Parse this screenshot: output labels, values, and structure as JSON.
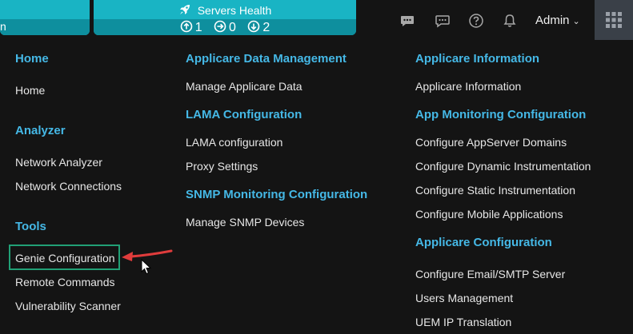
{
  "topbar": {
    "left_tile_fragment": "n",
    "servers_health": {
      "title": "Servers Health",
      "up_count": "1",
      "neutral_count": "0",
      "down_count": "2"
    },
    "icons": [
      "chat-bubble-icon",
      "comments-icon",
      "help-icon",
      "bell-icon"
    ],
    "user_label": "Admin",
    "apps_icon": "grid-icon"
  },
  "menu": {
    "col1": {
      "home_heading": "Home",
      "home_items": [
        "Home"
      ],
      "analyzer_heading": "Analyzer",
      "analyzer_items": [
        "Network Analyzer",
        "Network Connections"
      ],
      "tools_heading": "Tools",
      "tools_items": [
        "Genie Configuration",
        "Remote Commands",
        "Vulnerability Scanner"
      ]
    },
    "col2": {
      "data_mgmt_heading": "Applicare Data Management",
      "data_mgmt_items": [
        "Manage Applicare Data"
      ],
      "lama_heading": "LAMA Configuration",
      "lama_items": [
        "LAMA configuration",
        "Proxy Settings"
      ],
      "snmp_heading": "SNMP Monitoring Configuration",
      "snmp_items": [
        "Manage SNMP Devices"
      ]
    },
    "col3": {
      "info_heading": "Applicare Information",
      "info_items": [
        "Applicare Information"
      ],
      "app_mon_heading": "App Monitoring Configuration",
      "app_mon_items": [
        "Configure AppServer Domains",
        "Configure Dynamic Instrumentation",
        "Configure Static Instrumentation",
        "Configure Mobile Applications"
      ],
      "config_heading": "Applicare Configuration",
      "config_items": [
        "Configure Email/SMTP Server",
        "Users Management",
        "UEM IP Translation"
      ]
    }
  },
  "colors": {
    "background": "#141414",
    "tile_top": "#19b4c4",
    "tile_bottom": "#0e8f9e",
    "heading": "#45b8e6",
    "highlight_border": "#21a076",
    "annotation_arrow": "#e03c3c"
  }
}
